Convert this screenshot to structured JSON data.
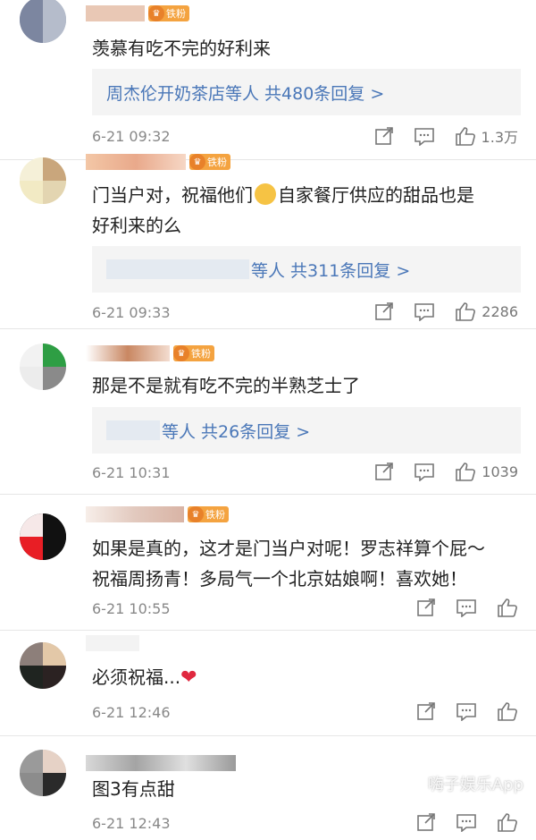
{
  "comments": [
    {
      "text": "羡慕有吃不完的好利来",
      "reply": "周杰伦开奶茶店等人 共480条回复 >",
      "time": "6-21 09:32",
      "likes": "1.3万",
      "badge": "铁粉"
    },
    {
      "text_a": "门当户对，祝福他们",
      "text_b": "自家餐厅供应的甜品也是",
      "text_line2": "好利来的么",
      "reply": "等人 共311条回复 >",
      "time": "6-21 09:33",
      "likes": "2286",
      "badge": "铁粉"
    },
    {
      "text": "那是不是就有吃不完的半熟芝士了",
      "reply": "等人 共26条回复 >",
      "time": "6-21 10:31",
      "likes": "1039",
      "badge": "铁粉"
    },
    {
      "text_line1": "如果是真的，这才是门当户对呢！罗志祥算个屁～",
      "text_line2": "祝福周扬青！多局气一个北京姑娘啊！喜欢她！",
      "time": "6-21 10:55",
      "badge": "铁粉"
    },
    {
      "text": "必须祝福...",
      "heart": "❤",
      "time": "6-21 12:46"
    },
    {
      "text": "图3有点甜",
      "time": "6-21 12:43"
    }
  ],
  "watermark": "嗨子娱乐App",
  "icons": [
    "share-icon",
    "comment-icon",
    "like-icon"
  ],
  "colors": {
    "link": "#4a77b8",
    "badge": "#f4a340",
    "heart": "#e0283f"
  }
}
